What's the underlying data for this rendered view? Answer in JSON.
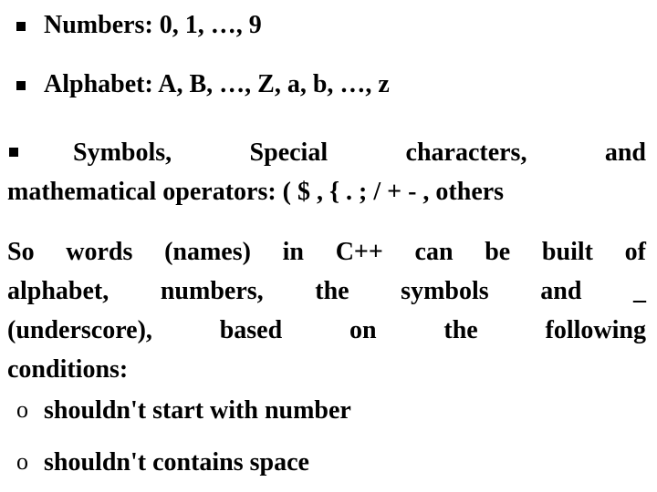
{
  "slide": {
    "background_color": "#FFFFFF",
    "text_color": "#000000",
    "bullets": [
      {
        "marker": "square-bullet",
        "marker_char": "§",
        "text": "Numbers: 0, 1, …, 9"
      },
      {
        "marker": "square-bullet",
        "marker_char": "§",
        "text": "Alphabet: A, B, …, Z, a, b, …, z"
      }
    ],
    "symbols_paragraph": {
      "marker": "square-bullet",
      "marker_char": "§",
      "line1": "Symbols, Special characters, and",
      "line2": "mathematical operators: ( $ , { . ; / + - , others",
      "full_text": "Symbols, Special characters, and mathematical operators: ( $ , { . ; / + - , others"
    },
    "body_paragraph": {
      "line1": "So words (names) in C++ can be built of",
      "line2": "alphabet, numbers, the symbols and   _",
      "line3": "(underscore), based on the following",
      "line4": "conditions:",
      "full_text": "So words (names) in C++ can be built of alphabet, numbers, the symbols and _ (underscore), based on the following conditions:"
    },
    "conditions": [
      {
        "marker": "o-bullet",
        "marker_char": "o",
        "text": "shouldn't start with number"
      },
      {
        "marker": "o-bullet",
        "marker_char": "o",
        "text": "shouldn't contains space"
      }
    ]
  }
}
